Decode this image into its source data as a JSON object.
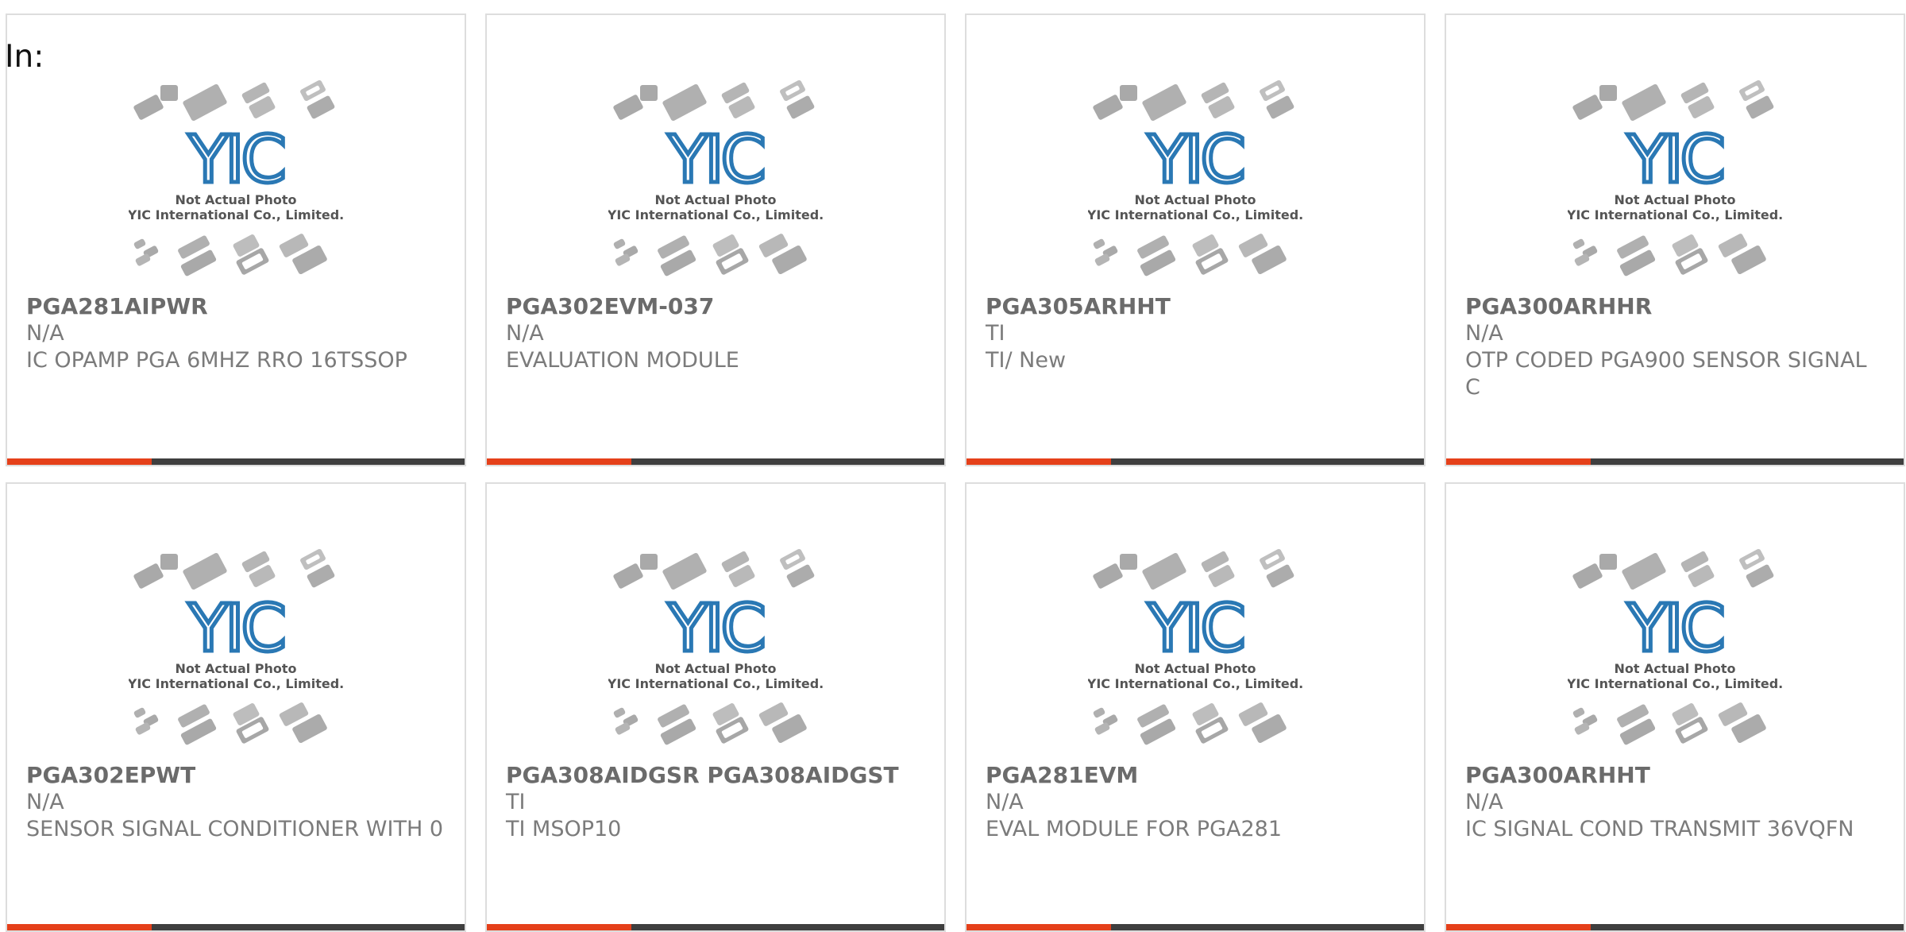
{
  "header": {
    "label": "In:"
  },
  "brand": {
    "logo_text": "YIC",
    "caption_line1": "Not Actual Photo",
    "caption_line2": "YIC International Co., Limited."
  },
  "colors": {
    "accent": "#e5401a",
    "bar": "#3f3f3f",
    "logo": "#2a78b4",
    "card_border": "#dddddd"
  },
  "products": [
    {
      "part": "PGA281AIPWR",
      "mfr": "N/A",
      "desc": "IC OPAMP PGA 6MHZ RRO 16TSSOP"
    },
    {
      "part": "PGA302EVM-037",
      "mfr": "N/A",
      "desc": "EVALUATION MODULE"
    },
    {
      "part": "PGA305ARHHT",
      "mfr": "TI",
      "desc": "TI/ New"
    },
    {
      "part": "PGA300ARHHR",
      "mfr": "N/A",
      "desc": "OTP CODED PGA900 SENSOR SIGNAL C"
    },
    {
      "part": "PGA302EPWT",
      "mfr": "N/A",
      "desc": "SENSOR SIGNAL CONDITIONER WITH 0"
    },
    {
      "part": "PGA308AIDGSR PGA308AIDGST",
      "mfr": "TI",
      "desc": "TI MSOP10"
    },
    {
      "part": "PGA281EVM",
      "mfr": "N/A",
      "desc": "EVAL MODULE FOR PGA281"
    },
    {
      "part": "PGA300ARHHT",
      "mfr": "N/A",
      "desc": "IC SIGNAL COND TRANSMIT 36VQFN"
    }
  ]
}
